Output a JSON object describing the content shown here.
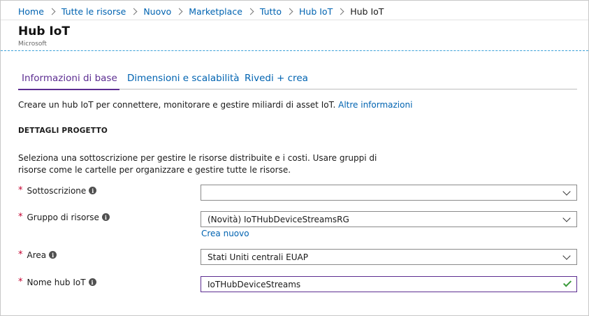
{
  "breadcrumb": {
    "items": [
      "Home",
      "Tutte le risorse",
      "Nuovo",
      "Marketplace",
      "Tutto",
      "Hub IoT"
    ],
    "current": "Hub IoT"
  },
  "blade": {
    "title": "Hub IoT",
    "subtitle": "Microsoft"
  },
  "tabs": [
    {
      "label": "Informazioni di base",
      "active": true
    },
    {
      "label": "Dimensioni e scalabilità",
      "active": false
    },
    {
      "label": "Rivedi + crea",
      "active": false
    }
  ],
  "intro": {
    "text": "Creare un hub IoT per connettere, monitorare e gestire miliardi di asset IoT.",
    "link": "Altre informazioni"
  },
  "section": {
    "heading": "DETTAGLI PROGETTO",
    "description": "Seleziona una sottoscrizione per gestire le risorse distribuite e i costi. Usare gruppi di risorse come le cartelle per organizzare e gestire tutte le risorse."
  },
  "fields": {
    "subscription": {
      "label": "Sottoscrizione",
      "value": ""
    },
    "resource_group": {
      "label": "Gruppo di risorse",
      "value": "(Novità) IoTHubDeviceStreamsRG",
      "create_link": "Crea nuovo"
    },
    "region": {
      "label": "Area",
      "value": "Stati Uniti centrali EUAP"
    },
    "hub_name": {
      "label": "Nome hub IoT",
      "value": "IoTHubDeviceStreams"
    }
  },
  "glyphs": {
    "required": "*",
    "info": "i"
  },
  "colors": {
    "link": "#0063b1",
    "accent": "#5c2d91",
    "required": "#c3002f",
    "valid": "#3a9a3a"
  }
}
